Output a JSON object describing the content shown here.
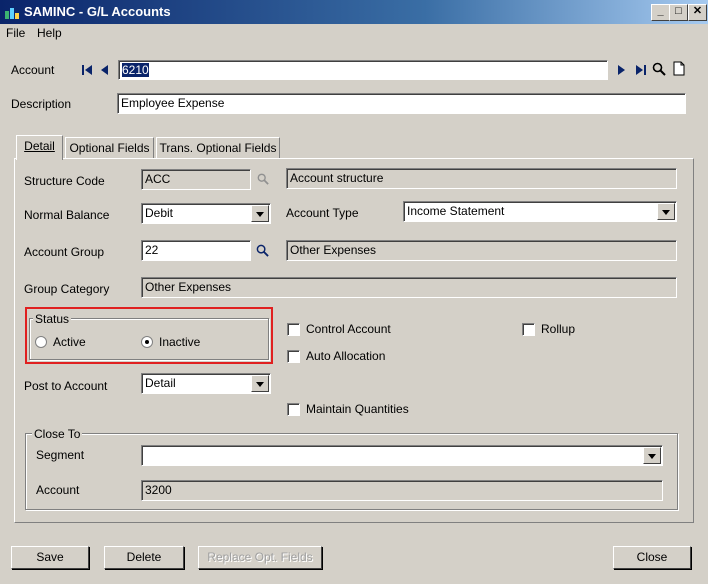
{
  "window": {
    "title": "SAMINC - G/L Accounts",
    "min": "_",
    "max": "□",
    "close": "✕"
  },
  "menu": {
    "file": "File",
    "help": "Help"
  },
  "header": {
    "account_label": "Account",
    "account_value": "6210",
    "description_label": "Description",
    "description_value": "Employee Expense"
  },
  "tabs": [
    {
      "label": "Detail"
    },
    {
      "label": "Optional Fields"
    },
    {
      "label": "Trans. Optional Fields"
    }
  ],
  "detail": {
    "structure_code_label": "Structure Code",
    "structure_code_value": "ACC",
    "structure_desc": "Account structure",
    "normal_balance_label": "Normal Balance",
    "normal_balance_value": "Debit",
    "account_type_label": "Account Type",
    "account_type_value": "Income Statement",
    "account_group_label": "Account Group",
    "account_group_value": "22",
    "account_group_desc": "Other Expenses",
    "group_category_label": "Group Category",
    "group_category_value": "Other Expenses",
    "status_label": "Status",
    "status_active": "Active",
    "status_inactive": "Inactive",
    "control_account": "Control Account",
    "rollup": "Rollup",
    "auto_allocation": "Auto Allocation",
    "post_to_label": "Post to Account",
    "post_to_value": "Detail",
    "maintain_quantities": "Maintain Quantities",
    "close_to_label": "Close To",
    "segment_label": "Segment",
    "segment_value": "",
    "close_account_label": "Account",
    "close_account_value": "3200"
  },
  "buttons": {
    "save": "Save",
    "delete": "Delete",
    "replace": "Replace Opt. Fields",
    "close": "Close"
  },
  "colors": {
    "highlight": "#e02020",
    "title_start": "#0a246a"
  }
}
